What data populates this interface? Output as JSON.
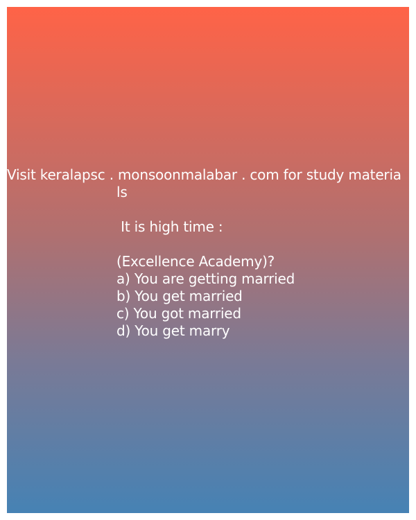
{
  "post": {
    "website_line_1": "Visit keralapsc . monsoonmalabar . com for study materia",
    "website_line_2": "ls",
    "prompt": " It is high time :",
    "source": "(Excellence Academy)?",
    "options": [
      "a) You are getting married",
      "b) You get married",
      "c) You got married",
      "d) You get marry"
    ]
  },
  "colors": {
    "gradient_top": "#ff6347",
    "gradient_bottom": "#4682b4",
    "text": "#ffffff"
  }
}
